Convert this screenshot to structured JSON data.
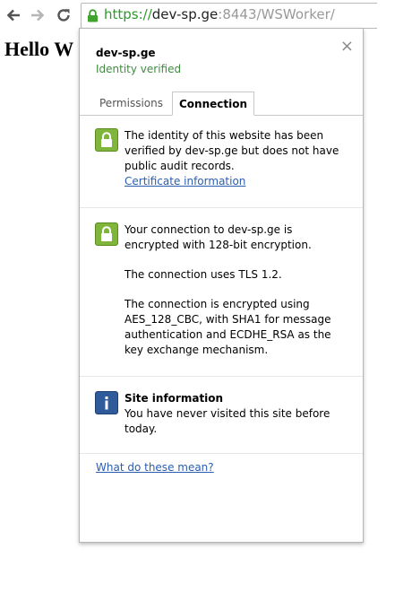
{
  "browser": {
    "url_scheme": "https://",
    "url_host": "dev-sp.ge",
    "url_rest": ":8443/WSWorker/"
  },
  "page": {
    "heading": "Hello W"
  },
  "popup": {
    "site_name": "dev-sp.ge",
    "identity_status": "Identity verified",
    "close_label": "×",
    "tabs": [
      {
        "label": "Permissions",
        "selected": false
      },
      {
        "label": "Connection",
        "selected": true
      }
    ],
    "identity": {
      "text": "The identity of this website has been verified by dev-sp.ge but does not have public audit records.",
      "link": "Certificate information"
    },
    "connection": {
      "paragraphs": [
        "Your connection to dev-sp.ge is encrypted with 128-bit encryption.",
        "The connection uses TLS 1.2.",
        "The connection is encrypted using AES_128_CBC, with SHA1 for message authentication and ECDHE_RSA as the key exchange mechanism."
      ]
    },
    "site_info": {
      "title": "Site information",
      "text": "You have never visited this site before today."
    },
    "help_link": "What do these mean?"
  },
  "colors": {
    "secure_green": "#2c9a2c",
    "verified_green": "#3e8d3e",
    "link_blue": "#2a5db0",
    "lock_badge": "#7fb53a",
    "info_badge": "#2f5b9b"
  }
}
